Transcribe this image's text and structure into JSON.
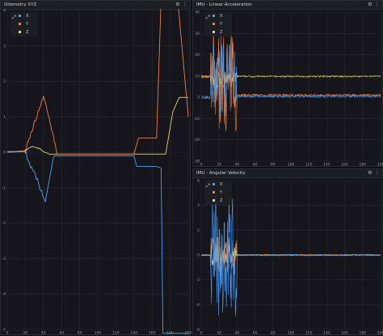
{
  "panels": {
    "odometry": {
      "title": "Odometry XYZ",
      "gear_icon": "gear-icon",
      "menu_icon": "more-vert-icon",
      "legend": [
        {
          "label": "X",
          "color": "#4a9ff5"
        },
        {
          "label": "Y",
          "color": "#f0803c"
        },
        {
          "label": "Z",
          "color": "#e8d36a"
        }
      ]
    },
    "linear_accel": {
      "title": "IMU - Linear Acceleration",
      "gear_icon": "gear-icon",
      "menu_icon": "more-vert-icon",
      "legend": [
        {
          "label": "X",
          "color": "#4a9ff5"
        },
        {
          "label": "Y",
          "color": "#f0803c"
        },
        {
          "label": "Z",
          "color": "#e8d36a"
        }
      ]
    },
    "angular_vel": {
      "title": "IMU - Angular Velocity",
      "gear_icon": "gear-icon",
      "menu_icon": "more-vert-icon",
      "legend": [
        {
          "label": "X",
          "color": "#4a9ff5"
        },
        {
          "label": "Y",
          "color": "#f0803c"
        },
        {
          "label": "Z",
          "color": "#e8d36a"
        }
      ]
    }
  },
  "glyphs": {
    "gear": "⚙",
    "menu": "⋮",
    "legend_tool": "⤢"
  },
  "axes": {
    "odometry": {
      "y_ticks": [
        "4",
        "3",
        "2",
        "1",
        "0",
        "-1",
        "-2",
        "-3",
        "-4",
        "-5"
      ],
      "x_ticks": [
        "0",
        "20",
        "40",
        "60",
        "80",
        "100",
        "120",
        "140",
        "160",
        "180",
        "200"
      ]
    },
    "linear_accel": {
      "y_ticks": [
        "40",
        "30",
        "20",
        "10",
        "0",
        "-10",
        "-20",
        "-30"
      ],
      "x_ticks": [
        "0",
        "20",
        "40",
        "60",
        "80",
        "100",
        "120",
        "140",
        "160",
        "180",
        "200"
      ]
    },
    "angular_vel": {
      "y_ticks": [
        "6",
        "4",
        "2",
        "0",
        "-2",
        "-4",
        "-6"
      ],
      "x_ticks": [
        "0",
        "20",
        "40",
        "60",
        "80",
        "100",
        "120",
        "140",
        "160",
        "180",
        "200"
      ]
    }
  }
}
